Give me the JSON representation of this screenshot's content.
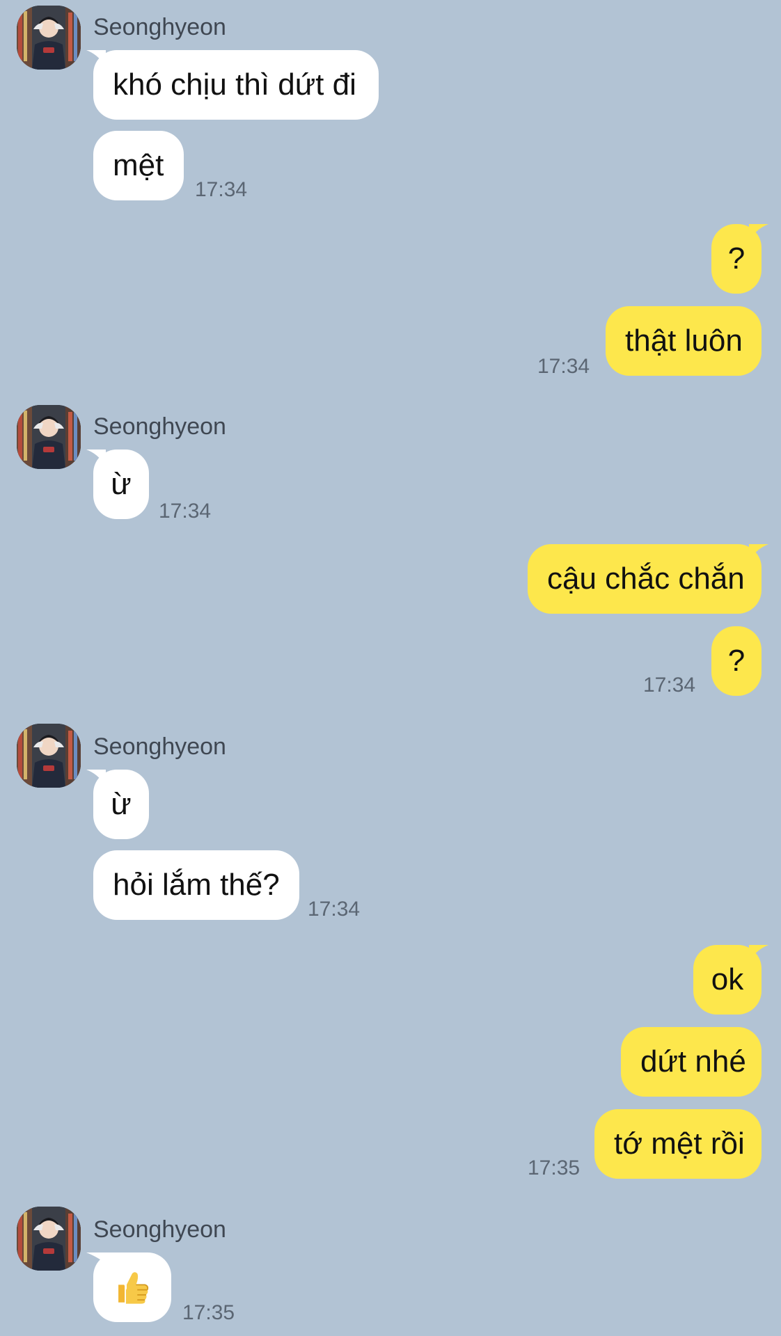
{
  "colors": {
    "background": "#b2c3d4",
    "incoming_bubble": "#ffffff",
    "outgoing_bubble": "#fde74c",
    "name_text": "#3f4752",
    "timestamp_text": "#5b6673"
  },
  "contact": {
    "name": "Seonghyeon",
    "avatar_icon": "person-photo-avatar"
  },
  "messages": {
    "m1": {
      "sender": "Seonghyeon",
      "text": "khó chịu thì dứt đi"
    },
    "m2": {
      "sender": "Seonghyeon",
      "text": "mệt",
      "time": "17:34"
    },
    "m3": {
      "sender": "me",
      "text": "?"
    },
    "m4": {
      "sender": "me",
      "text": "thật luôn",
      "time": "17:34"
    },
    "m5": {
      "sender": "Seonghyeon",
      "text": "ừ",
      "time": "17:34"
    },
    "m6": {
      "sender": "me",
      "text": "cậu chắc chắn"
    },
    "m7": {
      "sender": "me",
      "text": "?",
      "time": "17:34"
    },
    "m8": {
      "sender": "Seonghyeon",
      "text": "ừ"
    },
    "m9": {
      "sender": "Seonghyeon",
      "text": "hỏi lắm thế?",
      "time": "17:34"
    },
    "m10": {
      "sender": "me",
      "text": "ok"
    },
    "m11": {
      "sender": "me",
      "text": "dứt nhé"
    },
    "m12": {
      "sender": "me",
      "text": "tớ mệt rồi",
      "time": "17:35"
    },
    "m13": {
      "sender": "Seonghyeon",
      "emoji": "thumbs-up-icon",
      "time": "17:35"
    }
  }
}
